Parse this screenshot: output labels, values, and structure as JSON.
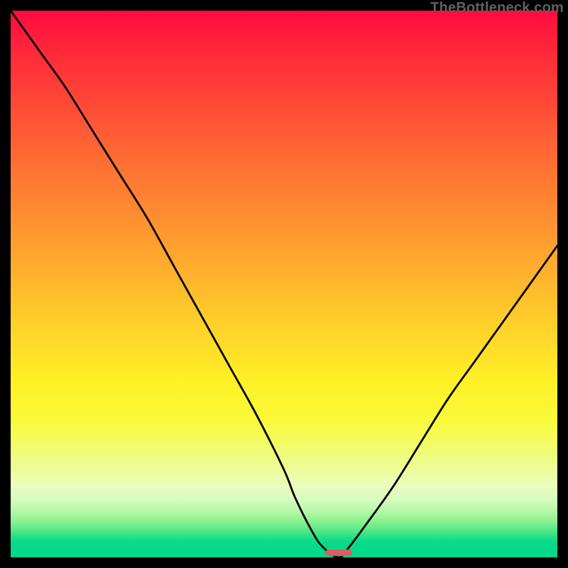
{
  "watermark": "TheBottleneck.com",
  "chart_data": {
    "type": "line",
    "title": "",
    "xlabel": "",
    "ylabel": "",
    "xlim": [
      0,
      100
    ],
    "ylim": [
      0,
      100
    ],
    "grid": false,
    "legend": false,
    "series": [
      {
        "name": "bottleneck-v-curve",
        "x": [
          0,
          5,
          10,
          15,
          20,
          25,
          30,
          35,
          40,
          45,
          50,
          52,
          55,
          57,
          60,
          62,
          65,
          70,
          75,
          80,
          85,
          90,
          95,
          100
        ],
        "values": [
          100,
          93,
          86,
          78,
          70,
          62,
          53,
          44,
          35,
          26,
          16,
          11,
          5,
          2,
          0,
          2,
          6,
          13,
          21,
          29,
          36,
          43,
          50,
          57
        ]
      }
    ],
    "optimal_marker": {
      "x_center": 60,
      "width_pct": 5
    },
    "background_gradient": {
      "top": "#ff0b3f",
      "mid": "#fff127",
      "bottom": "#03d78c"
    }
  }
}
